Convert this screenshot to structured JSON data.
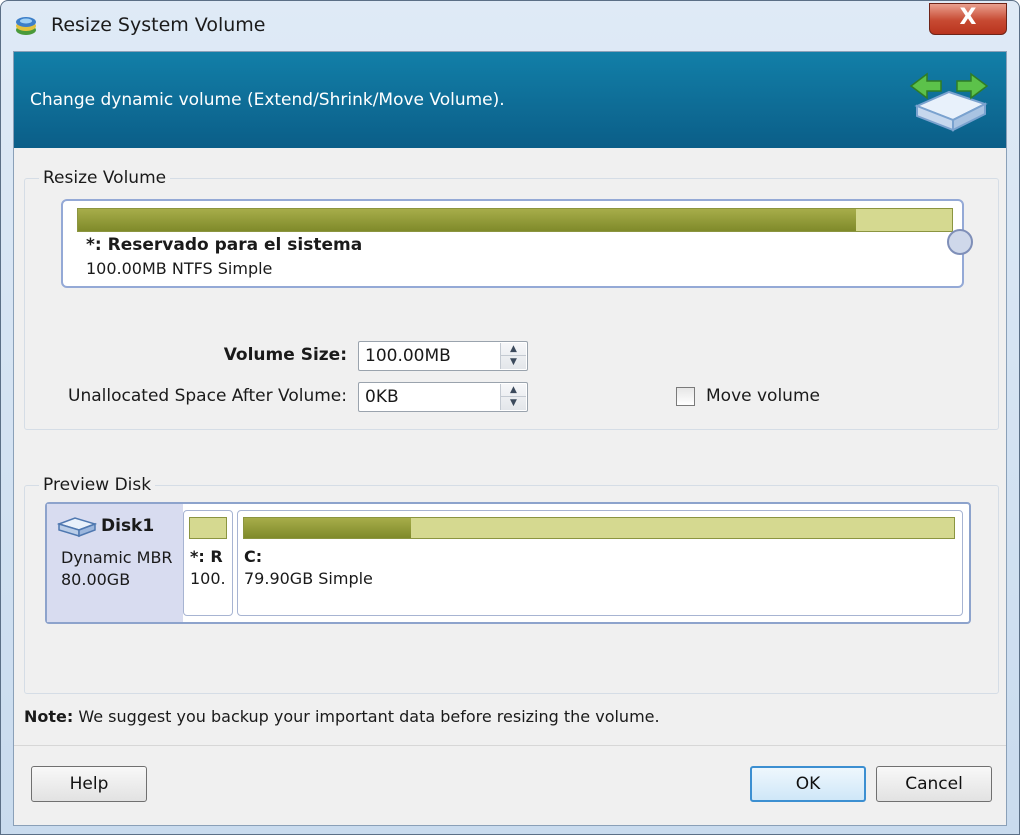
{
  "window": {
    "title": "Resize System Volume",
    "close_glyph": "X"
  },
  "banner": {
    "text": "Change dynamic volume (Extend/Shrink/Move Volume).",
    "icon": "resize-arrows-drive-icon"
  },
  "resize_group": {
    "label": "Resize Volume",
    "volume": {
      "name": "*: Reservado para el sistema",
      "description": "100.00MB NTFS Simple",
      "used_fraction": 0.89
    },
    "fields": {
      "volume_size_label": "Volume Size:",
      "volume_size_value": "100.00MB",
      "unallocated_after_label": "Unallocated Space After Volume:",
      "unallocated_after_value": "0KB"
    },
    "move_volume": {
      "label": "Move volume",
      "checked": false
    }
  },
  "preview_group": {
    "label": "Preview Disk",
    "disk": {
      "name": "Disk1",
      "type": "Dynamic MBR",
      "size": "80.00GB",
      "icon": "disk-drive-icon"
    },
    "partitions": [
      {
        "name": "*: R",
        "description": "100.",
        "used_fraction": 0.0
      },
      {
        "name": "C:",
        "description": "79.90GB Simple",
        "used_fraction": 0.235
      }
    ]
  },
  "note": {
    "prefix": "Note:",
    "text": " We suggest you backup your important data before resizing the volume."
  },
  "buttons": {
    "help": "Help",
    "ok": "OK",
    "cancel": "Cancel"
  },
  "colors": {
    "banner": "#0b6e98",
    "bar_used": "#8f9a35",
    "bar_free": "#d5d990",
    "selection_border": "#94a9d6"
  }
}
